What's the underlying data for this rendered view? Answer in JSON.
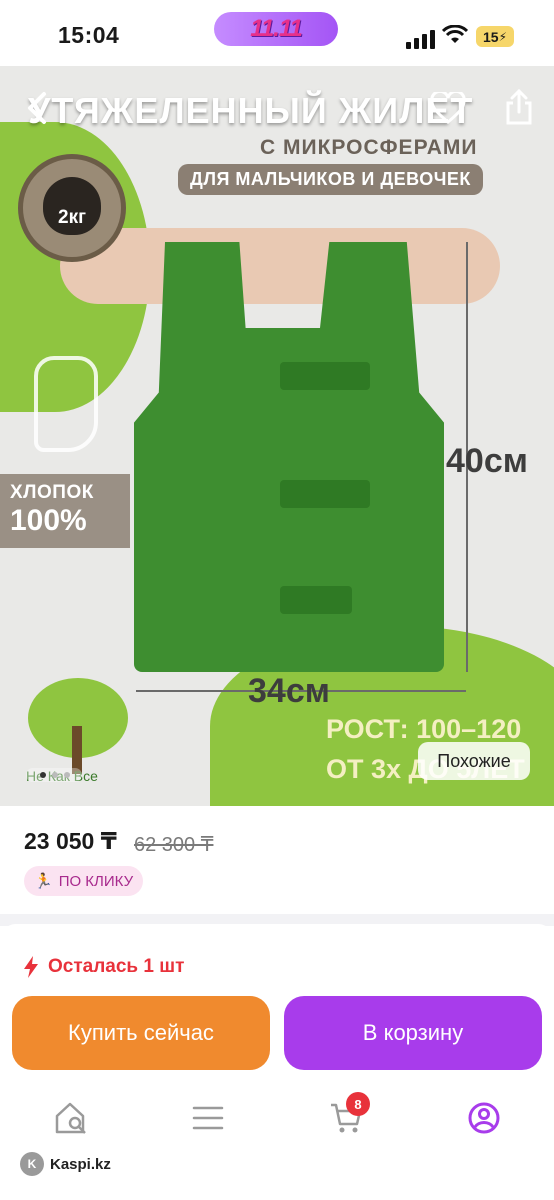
{
  "status_bar": {
    "time": "15:04",
    "promo_label": "11.11",
    "battery": "15"
  },
  "product_image": {
    "title": "УТЯЖЕЛЕННЫЙ ЖИЛЕТ",
    "subtitle": "С МИКРОСФЕРАМИ",
    "badge": "ДЛЯ МАЛЬЧИКОВ И ДЕВОЧЕК",
    "weight": "2кг",
    "cotton_line1": "ХЛОПОК",
    "cotton_line2": "100%",
    "height_dim": "40см",
    "width_dim": "34см",
    "height_range": "РОСТ: 100–120",
    "age_range": "ОТ 3х ДО 5ЛЕТ",
    "brand": "Не Как Все",
    "similar_button": "Похожие",
    "colors": {
      "vest": "#3e8e30",
      "accent_green": "#8fc540"
    }
  },
  "price": {
    "current": "23 050 ₸",
    "old": "62 300 ₸",
    "badge": "ПО КЛИКУ"
  },
  "stock": {
    "text": "Осталась 1 шт"
  },
  "actions": {
    "buy_now": "Купить сейчас",
    "add_to_cart": "В корзину",
    "colors": {
      "buy": "#f08a2e",
      "cart": "#a83ceb"
    }
  },
  "bottom_nav": {
    "items": [
      "home-search-icon",
      "catalog-icon",
      "cart-icon",
      "profile-icon"
    ],
    "cart_count": "8"
  },
  "browser": {
    "domain": "Kaspi.kz"
  }
}
